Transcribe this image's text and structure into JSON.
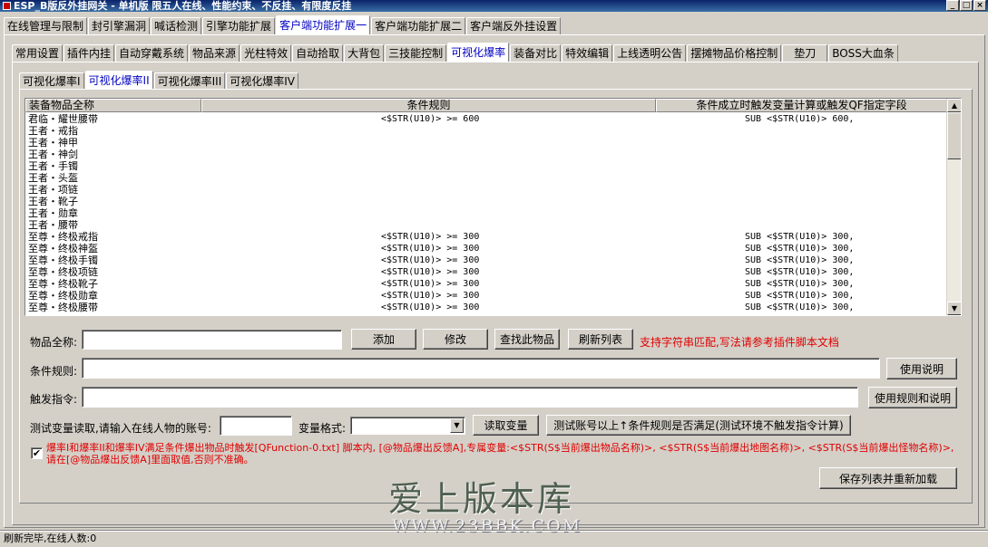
{
  "window": {
    "title": "ESP_B版反外挂网关 - 单机版 限五人在线、性能约束、不反挂、有限度反挂",
    "minimize": "_",
    "maximize": "□",
    "close": "×"
  },
  "tabs_l1": [
    "在线管理与限制",
    "封引擎漏洞",
    "喊话检测",
    "引擎功能扩展",
    "客户端功能扩展一",
    "客户端功能扩展二",
    "客户端反外挂设置"
  ],
  "tabs_l2": [
    "常用设置",
    "插件内挂",
    "自动穿戴系统",
    "物品来源",
    "光柱特效",
    "自动拾取",
    "大背包",
    "三技能控制",
    "可视化爆率",
    "装备对比",
    "特效编辑",
    "上线透明公告",
    "摆摊物品价格控制",
    "垫刀",
    "BOSS大血条"
  ],
  "tabs_l3": [
    "可视化爆率I",
    "可视化爆率II",
    "可视化爆率III",
    "可视化爆率IV"
  ],
  "grid": {
    "headers": [
      "装备物品全称",
      "条件规则",
      "条件成立时触发变量计算或触发QF指定字段"
    ],
    "rows": [
      [
        "君临・耀世腰带",
        "<$STR(U10)> >= 600",
        "SUB <$STR(U10)> 600,"
      ],
      [
        "王者・戒指",
        "",
        ""
      ],
      [
        "王者・神甲",
        "",
        ""
      ],
      [
        "王者・神剑",
        "",
        ""
      ],
      [
        "王者・手镯",
        "",
        ""
      ],
      [
        "王者・头盔",
        "",
        ""
      ],
      [
        "王者・项链",
        "",
        ""
      ],
      [
        "王者・靴子",
        "",
        ""
      ],
      [
        "王者・勋章",
        "",
        ""
      ],
      [
        "王者・腰带",
        "",
        ""
      ],
      [
        "至尊・终极戒指",
        "<$STR(U10)> >= 300",
        "SUB <$STR(U10)> 300,"
      ],
      [
        "至尊・终极神盔",
        "<$STR(U10)> >= 300",
        "SUB <$STR(U10)> 300,"
      ],
      [
        "至尊・终极手镯",
        "<$STR(U10)> >= 300",
        "SUB <$STR(U10)> 300,"
      ],
      [
        "至尊・终极项链",
        "<$STR(U10)> >= 300",
        "SUB <$STR(U10)> 300,"
      ],
      [
        "至尊・终极靴子",
        "<$STR(U10)> >= 300",
        "SUB <$STR(U10)> 300,"
      ],
      [
        "至尊・终极勋章",
        "<$STR(U10)> >= 300",
        "SUB <$STR(U10)> 300,"
      ],
      [
        "至尊・终极腰带",
        "<$STR(U10)> >= 300",
        "SUB <$STR(U10)> 300,"
      ]
    ]
  },
  "form": {
    "item_label": "物品全称:",
    "item_value": "",
    "add_label": "添加",
    "modify_label": "修改",
    "find_label": "查找此物品",
    "refresh_label": "刷新列表",
    "hint": "支持字符串匹配,写法请参考插件脚本文档",
    "cond_label": "条件规则:",
    "cond_value": "",
    "help_label": "使用说明",
    "trigger_label": "触发指令:",
    "trigger_value": "",
    "rules_help_label": "使用规则和说明",
    "test_label": "测试变量读取,请输入在线人物的账号:",
    "test_account": "",
    "var_format_label": "变量格式:",
    "var_format_value": "",
    "read_var_label": "读取变量",
    "test_rule_label": "测试账号以上↑条件规则是否满足(测试环境不触发指令计算)",
    "checkbox_checked": true,
    "note": "爆率I和爆率II和爆率IV满足条件爆出物品时触发[QFunction-0.txt] 脚本内, [@物品爆出反馈A],专属变量:<$STR(S$当前爆出物品名称)>, <$STR(S$当前爆出地图名称)>, <$STR(S$当前爆出怪物名称)>,请在[@物品爆出反馈A]里面取值,否则不准确。",
    "save_label": "保存列表并重新加载"
  },
  "watermark": {
    "main": "爱上版本库",
    "url": "WWW.23BBK.COM"
  },
  "status": "刷新完毕,在线人数:0"
}
